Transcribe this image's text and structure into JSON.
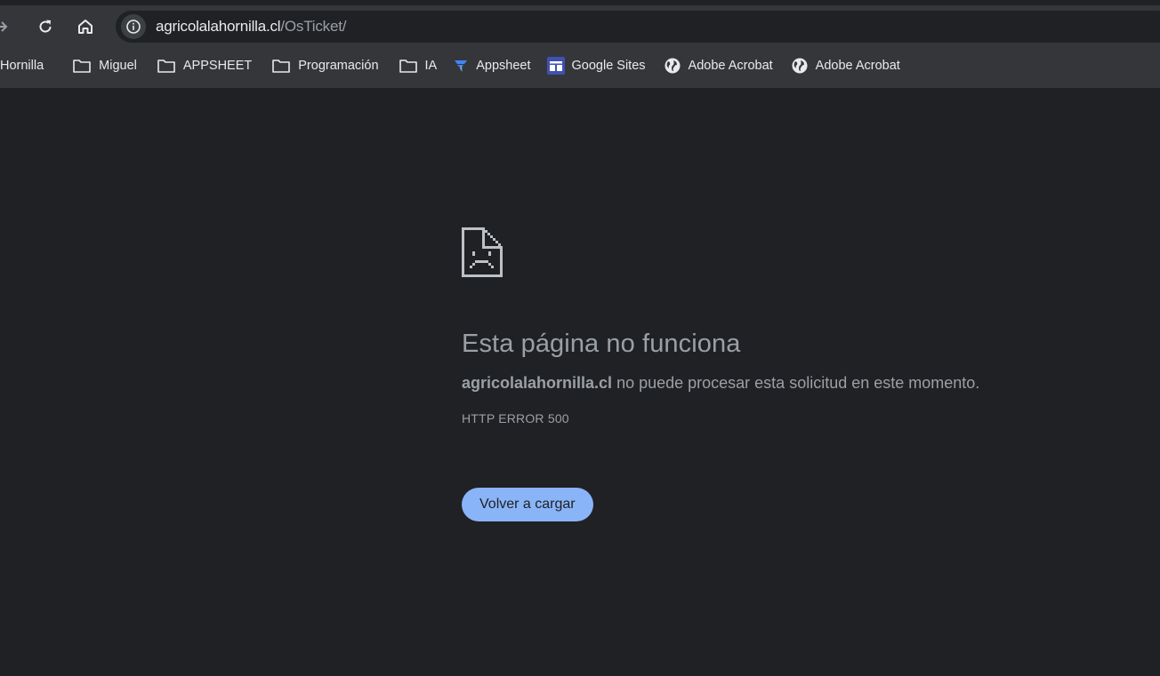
{
  "toolbar": {
    "url_host": "agricolalahornilla.cl",
    "url_path": "/OsTicket/"
  },
  "bookmarks": [
    {
      "label": "Hornilla",
      "icon": "none"
    },
    {
      "label": "Miguel",
      "icon": "folder-icon"
    },
    {
      "label": "APPSHEET",
      "icon": "folder-icon"
    },
    {
      "label": "Programación",
      "icon": "folder-icon"
    },
    {
      "label": "IA",
      "icon": "folder-icon"
    },
    {
      "label": "Appsheet",
      "icon": "appsheet-icon"
    },
    {
      "label": "Google Sites",
      "icon": "google-sites-icon"
    },
    {
      "label": "Adobe Acrobat",
      "icon": "globe-icon"
    },
    {
      "label": "Adobe Acrobat",
      "icon": "globe-icon"
    }
  ],
  "error_page": {
    "title": "Esta página no funciona",
    "host": "agricolalahornilla.cl",
    "message": " no puede procesar esta solicitud en este momento.",
    "error_code": "HTTP ERROR 500",
    "reload_label": "Volver a cargar"
  },
  "colors": {
    "background": "#202124",
    "toolbar": "#35363a",
    "text_primary": "#e8eaed",
    "text_secondary": "#9aa0a6",
    "button": "#8ab4f8"
  }
}
